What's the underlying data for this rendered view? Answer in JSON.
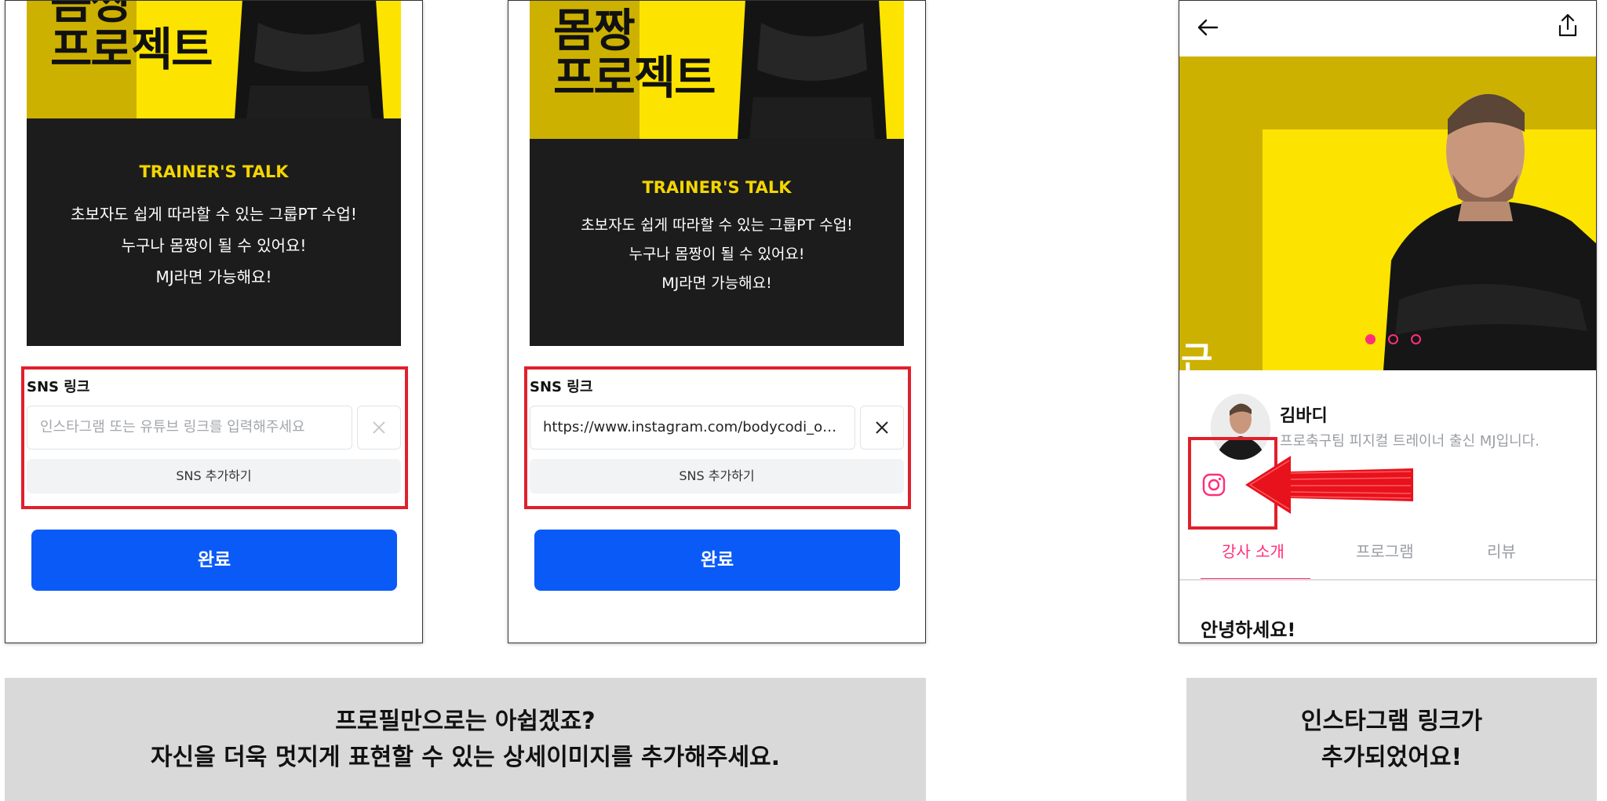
{
  "banner": {
    "title_line1": "몸짱",
    "title_line2": "프로젝트"
  },
  "trainers_talk": {
    "title": "TRAINER'S TALK",
    "lines": [
      "초보자도 쉽게 따라할 수 있는 그룹PT 수업!",
      "누구나 몸짱이 될 수 있어요!",
      "MJ라면 가능해요!"
    ]
  },
  "screen1": {
    "sns_label": "SNS 링크",
    "sns_placeholder": "인스타그램 또는 유튜브 링크를 입력해주세요",
    "sns_add_label": "SNS 추가하기",
    "done_label": "완료"
  },
  "screen2": {
    "sns_label": "SNS 링크",
    "sns_value": "https://www.instagram.com/bodycodi_o…",
    "sns_add_label": "SNS 추가하기",
    "done_label": "완료"
  },
  "screen3": {
    "hero_partial_text": "근",
    "profile_name": "김바디",
    "profile_desc": "프로축구팀 피지컬 트레이너 출신 MJ입니다.",
    "tabs": [
      "강사 소개",
      "프로그램",
      "리뷰"
    ],
    "active_tab": "강사 소개",
    "section_title": "안녕하세요!",
    "carousel": {
      "count": 3,
      "active_index": 0
    }
  },
  "captions": {
    "left_line1": "프로필만으로는 아쉽겠죠?",
    "left_line2": "자신을 더욱 멋지게 표현할 수 있는 상세이미지를 추가해주세요.",
    "right_line1": "인스타그램 링크가",
    "right_line2": "추가되었어요!"
  },
  "colors": {
    "banner_yellow": "#fde400",
    "banner_dark_yellow": "#cdb100",
    "card_dark": "#1c1c1c",
    "talk_yellow": "#f3d600",
    "primary_blue": "#0a5af7",
    "accent_pink": "#ff2e7a",
    "highlight_red": "#e0202c",
    "caption_gray": "#d9d9d9"
  },
  "icons": [
    "close-icon",
    "back-arrow-icon",
    "share-icon",
    "instagram-icon",
    "red-arrow-annotation"
  ]
}
